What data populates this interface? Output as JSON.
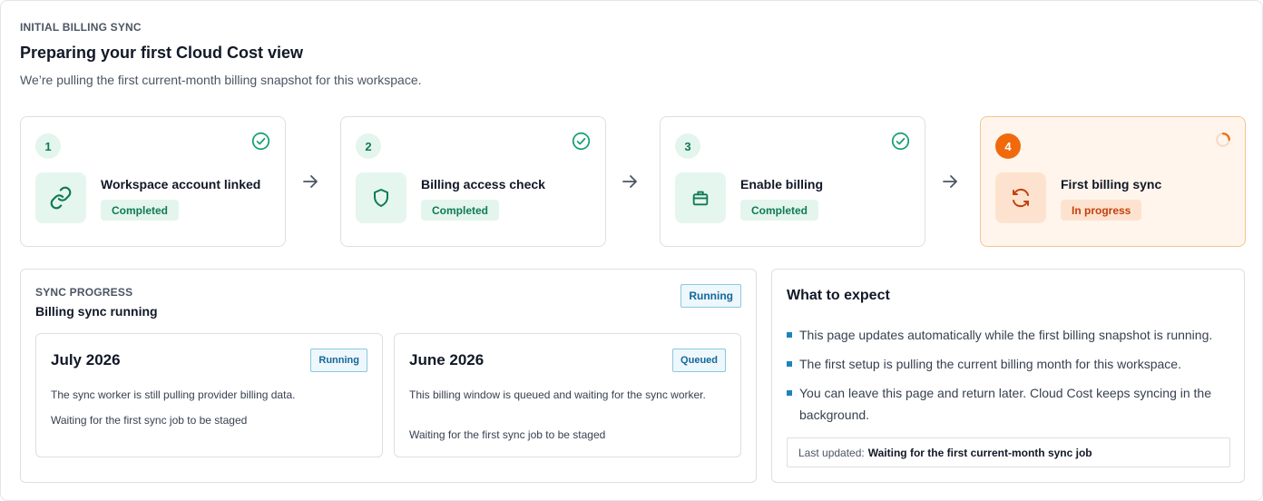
{
  "header": {
    "eyebrow": "INITIAL BILLING SYNC",
    "title": "Preparing your first Cloud Cost view",
    "subtitle": "We’re pulling the first current-month billing snapshot for this workspace."
  },
  "steps": [
    {
      "number": "1",
      "label": "Workspace account linked",
      "status": "Completed",
      "icon": "link-icon"
    },
    {
      "number": "2",
      "label": "Billing access check",
      "status": "Completed",
      "icon": "shield-icon"
    },
    {
      "number": "3",
      "label": "Enable billing",
      "status": "Completed",
      "icon": "briefcase-icon"
    },
    {
      "number": "4",
      "label": "First billing sync",
      "status": "In progress",
      "icon": "sync-icon"
    }
  ],
  "sync": {
    "eyebrow": "SYNC PROGRESS",
    "title": "Billing sync running",
    "status": "Running",
    "months": [
      {
        "title": "July 2026",
        "status": "Running",
        "description": "The sync worker is still pulling provider billing data.",
        "detail": "Waiting for the first sync job to be staged"
      },
      {
        "title": "June 2026",
        "status": "Queued",
        "description": "This billing window is queued and waiting for the sync worker.",
        "detail": "Waiting for the first sync job to be staged"
      }
    ]
  },
  "expect": {
    "title": "What to expect",
    "items": [
      "This page updates automatically while the first billing snapshot is running.",
      "The first setup is pulling the current billing month for this workspace.",
      "You can leave this page and return later. Cloud Cost keeps syncing in the background."
    ],
    "last_updated_label": "Last updated:",
    "last_updated_value": "Waiting for the first current-month sync job"
  },
  "colors": {
    "success": "#0f7a55",
    "success_bg": "#e4f5ee",
    "accent_orange": "#f06a0c",
    "info_blue": "#13679a"
  }
}
